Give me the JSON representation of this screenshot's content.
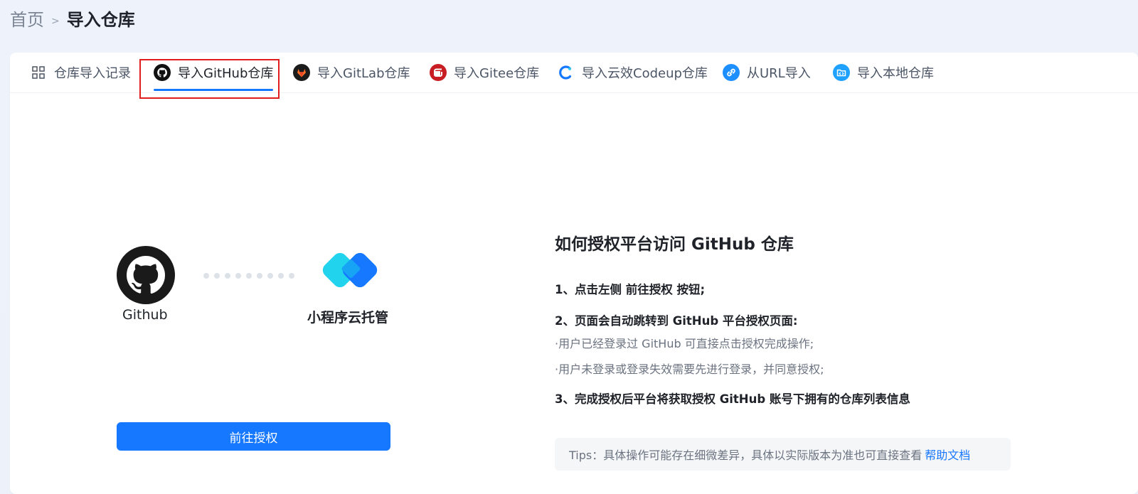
{
  "breadcrumb": {
    "home": "首页",
    "separator": ">",
    "current": "导入仓库"
  },
  "tabs": [
    {
      "label": "仓库导入记录",
      "icon": "grid-icon",
      "active": false
    },
    {
      "label": "导入GitHub仓库",
      "icon": "github-icon",
      "active": true
    },
    {
      "label": "导入GitLab仓库",
      "icon": "gitlab-icon",
      "active": false
    },
    {
      "label": "导入Gitee仓库",
      "icon": "gitee-icon",
      "active": false
    },
    {
      "label": "导入云效Codeup仓库",
      "icon": "codeup-icon",
      "active": false
    },
    {
      "label": "从URL导入",
      "icon": "link-icon",
      "active": false
    },
    {
      "label": "导入本地仓库",
      "icon": "folder-code-icon",
      "active": false
    }
  ],
  "illustration": {
    "left_caption": "Github",
    "right_caption": "小程序云托管"
  },
  "authorize_button": "前往授权",
  "guide": {
    "title": "如何授权平台访问 GitHub 仓库",
    "step1": "1、点击左侧 前往授权 按钮;",
    "step2": "2、页面会自动跳转到 GitHub 平台授权页面:",
    "step2_sub1": "·用户已经登录过 GitHub 可直接点击授权完成操作;",
    "step2_sub2": "·用户未登录或登录失效需要先进行登录，并同意授权;",
    "step3": "3、完成授权后平台将获取授权 GitHub 账号下拥有的仓库列表信息"
  },
  "tips": {
    "text": "Tips：具体操作可能存在细微差异，具体以实际版本为准也可直接查看",
    "link": "帮助文档"
  },
  "colors": {
    "primary": "#1677ff",
    "highlight": "#e21d1d"
  }
}
